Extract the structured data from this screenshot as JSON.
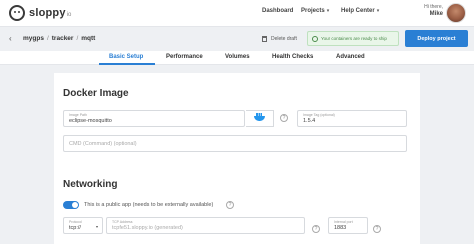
{
  "brand": {
    "name": "sloppy",
    "suffix": "io"
  },
  "nav": {
    "dashboard": "Dashboard",
    "projects": "Projects",
    "help": "Help Center"
  },
  "user": {
    "greeting": "Hi there,",
    "name": "Mike"
  },
  "breadcrumb": {
    "items": [
      "mygps",
      "tracker",
      "mqtt"
    ]
  },
  "actions": {
    "delete": "Delete draft",
    "ready": "Your containers are ready to ship",
    "deploy": "Deploy project"
  },
  "tabs": [
    "Basic Setup",
    "Performance",
    "Volumes",
    "Health Checks",
    "Advanced"
  ],
  "docker": {
    "title": "Docker Image",
    "image_label": "Image Path",
    "image_value": "eclipse-mosquitto",
    "tag_label": "Image Tag (optional)",
    "tag_value": "1.5.4",
    "cmd_placeholder": "CMD (Command) (optional)"
  },
  "networking": {
    "title": "Networking",
    "public_label": "This is a public app (needs to be externally available)",
    "protocol_label": "Protocol",
    "protocol_value": "tcp://",
    "url_label": "TCP Address",
    "url_placeholder": "tcpfe51.sloppy.io (generated)",
    "port_label": "Internal port",
    "port_value": "1883"
  },
  "colors": {
    "accent": "#2a7fd4",
    "success_bg": "#e9f6e9",
    "success_text": "#4a8a4a"
  }
}
